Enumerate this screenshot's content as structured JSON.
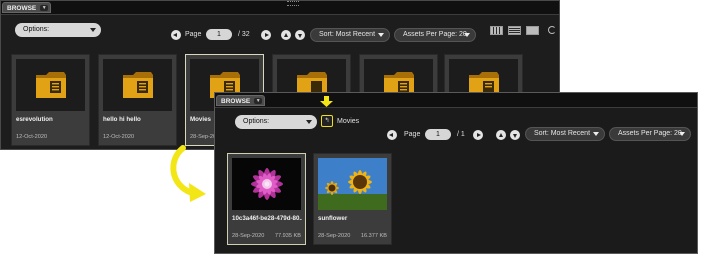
{
  "back_panel": {
    "tab_label": "BROWSE",
    "options_label": "Options:",
    "pager": {
      "label": "Page",
      "current": "1",
      "total": "/ 32"
    },
    "sort_label": "Sort: Most Recent",
    "per_page_label": "Assets Per Page: 20",
    "items": [
      {
        "name": "esrevolution",
        "date": "12-Oct-2020"
      },
      {
        "name": "hello hi hello",
        "date": "12-Oct-2020"
      },
      {
        "name": "Movies",
        "date": "28-Sep-20"
      },
      {
        "name": "",
        "date": ""
      },
      {
        "name": "",
        "date": ""
      },
      {
        "name": "",
        "date": ""
      }
    ]
  },
  "front_panel": {
    "tab_label": "BROWSE",
    "options_label": "Options:",
    "breadcrumb": "Movies",
    "up_glyph": "↰",
    "pager": {
      "label": "Page",
      "current": "1",
      "total": "/ 1"
    },
    "sort_label": "Sort: Most Recent",
    "per_page_label": "Assets Per Page: 20",
    "items": [
      {
        "name": "10c3a46f-be28-479d-80...",
        "date": "28-Sep-2020",
        "size": "77.935 KB"
      },
      {
        "name": "sunflower",
        "date": "28-Sep-2020",
        "size": "16.377 KB"
      }
    ]
  },
  "colors": {
    "annotation_yellow": "#f3e617",
    "folder_yellow": "#e2a215",
    "panel_bg": "#1d1d1d"
  }
}
